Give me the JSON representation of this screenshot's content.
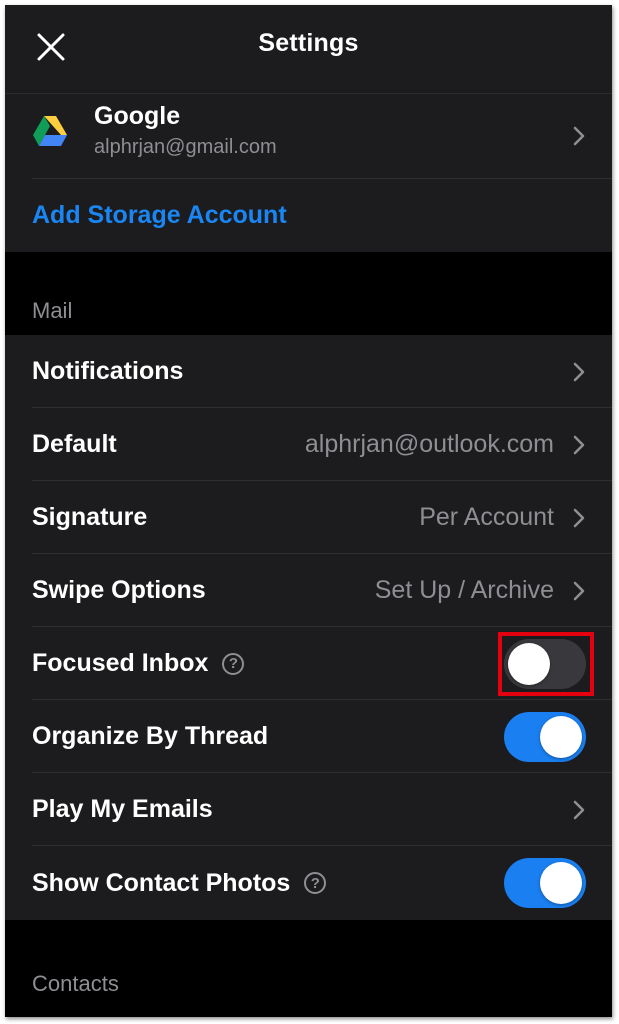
{
  "header": {
    "title": "Settings",
    "close_icon": "close-icon"
  },
  "storage": {
    "account": {
      "name": "Google",
      "email": "alphrjan@gmail.com",
      "icon": "google-drive-icon"
    },
    "add_label": "Add Storage Account"
  },
  "mail": {
    "section_label": "Mail",
    "rows": {
      "notifications": {
        "label": "Notifications"
      },
      "default": {
        "label": "Default",
        "value": "alphrjan@outlook.com"
      },
      "signature": {
        "label": "Signature",
        "value": "Per Account"
      },
      "swipe": {
        "label": "Swipe Options",
        "value": "Set Up / Archive"
      },
      "focused": {
        "label": "Focused Inbox",
        "help": "?",
        "enabled": false
      },
      "organize": {
        "label": "Organize By Thread",
        "enabled": true
      },
      "play": {
        "label": "Play My Emails"
      },
      "photos": {
        "label": "Show Contact Photos",
        "help": "?",
        "enabled": true
      }
    }
  },
  "contacts": {
    "section_label": "Contacts"
  },
  "colors": {
    "background": "#000000",
    "cell": "#1c1c1e",
    "accent_blue": "#1a86f3",
    "toggle_on": "#1a7ff0",
    "toggle_off": "#39393d",
    "secondary_text": "#8e8e93",
    "highlight_box": "#e3000f"
  }
}
